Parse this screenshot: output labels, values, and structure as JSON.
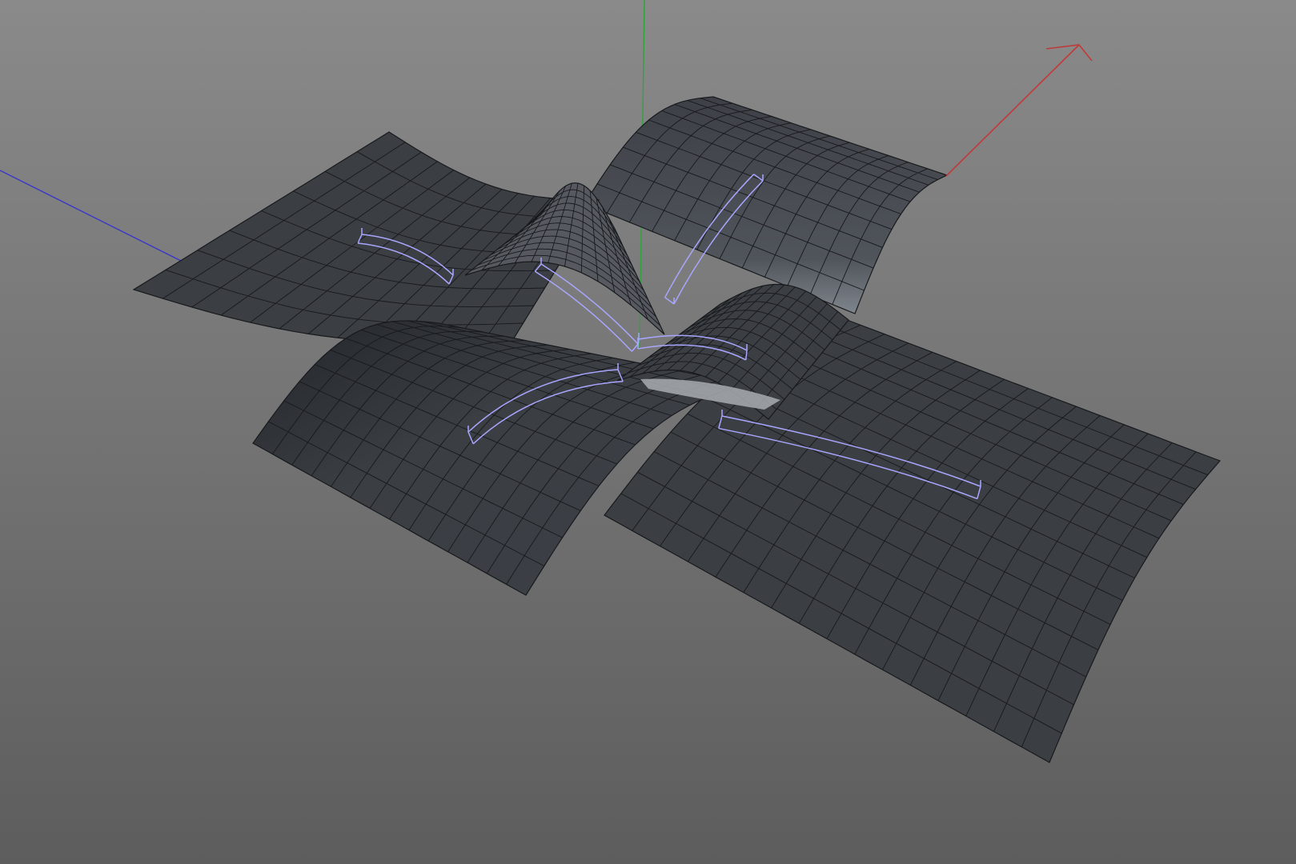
{
  "viewport": {
    "background_top": "#8a8a8a",
    "background_bottom": "#5d5d5d",
    "mesh_fill": "#3b3e43",
    "mesh_fill_light": "#565a60",
    "mesh_highlight": "#a9adb2",
    "wire_color": "#17191c",
    "deformer_color": "#a9a6ff"
  },
  "axes": [
    {
      "name": "x-axis",
      "color": "#c13a3a"
    },
    {
      "name": "y-axis",
      "color": "#2fa33c"
    },
    {
      "name": "z-axis",
      "color": "#3737c8"
    }
  ],
  "objects": [
    {
      "name": "bent-plane-left",
      "kind": "mesh"
    },
    {
      "name": "bent-plane-back",
      "kind": "mesh"
    },
    {
      "name": "bent-plane-front-left",
      "kind": "mesh"
    },
    {
      "name": "bent-plane-front-right",
      "kind": "mesh"
    },
    {
      "name": "bent-plane-center-left",
      "kind": "mesh"
    },
    {
      "name": "bent-plane-center-right",
      "kind": "mesh"
    }
  ],
  "deformers": [
    {
      "name": "bend-deformer-left"
    },
    {
      "name": "bend-deformer-back"
    },
    {
      "name": "bend-deformer-center"
    },
    {
      "name": "bend-deformer-center-right"
    },
    {
      "name": "bend-deformer-front-left"
    },
    {
      "name": "bend-deformer-front-right"
    }
  ]
}
